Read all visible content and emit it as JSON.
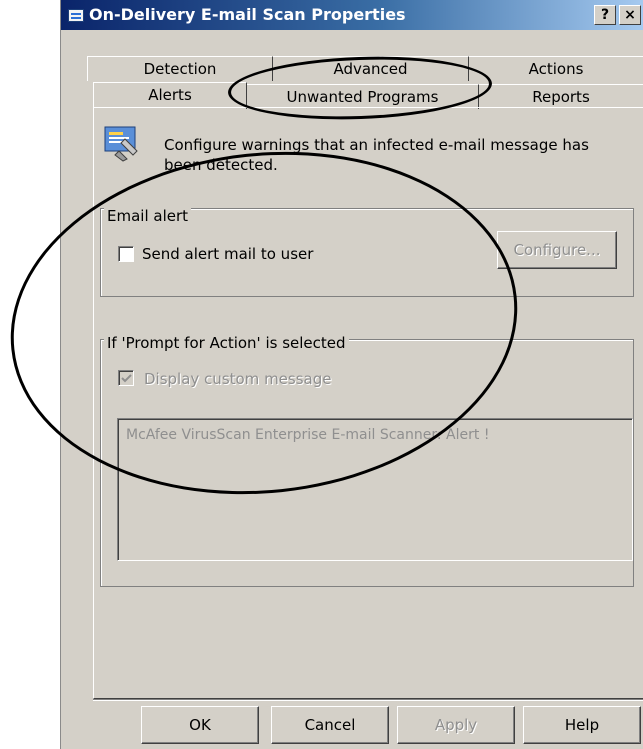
{
  "window": {
    "title": "On-Delivery E-mail Scan Properties",
    "help_button": "?",
    "close_button": "×"
  },
  "tabs": {
    "back_row": [
      "Detection",
      "Advanced",
      "Actions"
    ],
    "front_row": [
      "Alerts",
      "Unwanted Programs",
      "Reports"
    ],
    "active": "Alerts"
  },
  "page": {
    "icon": "alert-settings-icon",
    "description": "Configure warnings that an infected e-mail message has been detected."
  },
  "email_alert": {
    "group_label": "Email alert",
    "checkbox_label": "Send alert mail to user",
    "checked": false,
    "configure_button": "Configure..."
  },
  "prompt_action": {
    "group_label": "If 'Prompt for Action' is selected",
    "checkbox_label": "Display custom message",
    "checked": true,
    "message": "McAfee VirusScan Enterprise E-mail Scanner: Alert !"
  },
  "buttons": {
    "ok": "OK",
    "cancel": "Cancel",
    "apply": "Apply",
    "help": "Help"
  },
  "colors": {
    "dialog_bg": "#d4d0c8",
    "title_gradient_start": "#0a246a",
    "title_gradient_end": "#a6caf0",
    "disabled_text": "#8f8f8f",
    "annotation_ink": "#000000"
  }
}
